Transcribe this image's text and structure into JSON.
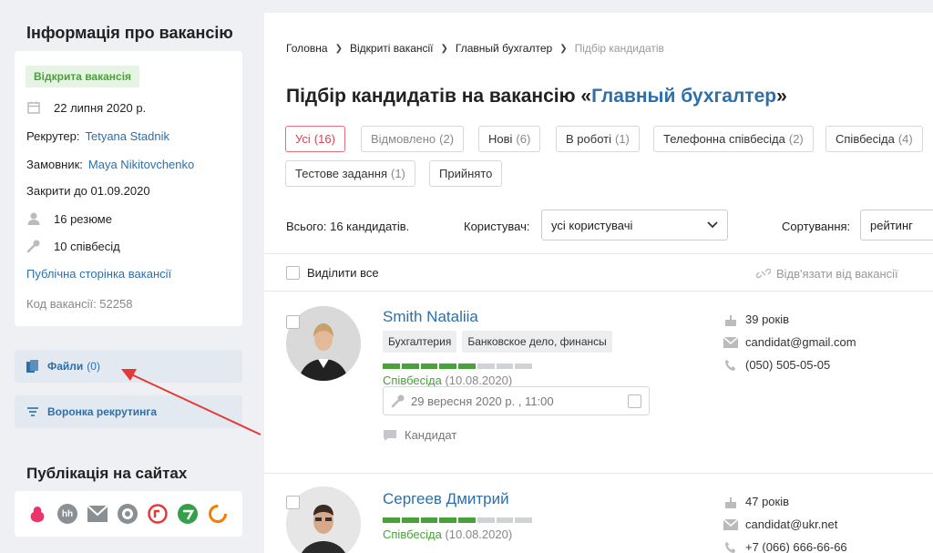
{
  "sidebar": {
    "title": "Інформація про вакансію",
    "status_badge": "Відкрита вакансія",
    "date": "22 липня 2020 р.",
    "recruiter_label": "Рекрутер:",
    "recruiter_name": "Tetyana Stadnik",
    "customer_label": "Замовник:",
    "customer_name": "Maya Nikitovchenko",
    "close_by": "Закрити до 01.09.2020",
    "resumes": "16 резюме",
    "interviews": "10 співбесід",
    "public_link": "Публічна сторінка вакансії",
    "vacancy_code": "Код вакансії: 52258",
    "files_label": "Файли",
    "files_count": "(0)",
    "funnel_label": "Воронка рекрутинга",
    "publication_title": "Публікація на сайтах"
  },
  "breadcrumb": {
    "home": "Головна",
    "open_vacancies": "Відкриті вакансії",
    "vacancy": "Главный бухгалтер",
    "current": "Підбір кандидатів"
  },
  "page": {
    "title_prefix": "Підбір кандидатів на вакансію «",
    "title_vacancy": "Главный бухгалтер",
    "title_suffix": "»"
  },
  "tabs": [
    {
      "label": "Усі",
      "count": "(16)"
    },
    {
      "label": "Відмовлено",
      "count": "(2)"
    },
    {
      "label": "Нові",
      "count": "(6)"
    },
    {
      "label": "В роботі",
      "count": "(1)"
    },
    {
      "label": "Телефонна співбесіда",
      "count": "(2)"
    },
    {
      "label": "Співбесіда",
      "count": "(4)"
    },
    {
      "label": "Тестове задання",
      "count": "(1)"
    },
    {
      "label": "Прийнято",
      "count": ""
    }
  ],
  "filters": {
    "total": "Всього: 16 кандидатів.",
    "user_label": "Користувач:",
    "user_value": "усі користувачі",
    "sort_label": "Сортування:",
    "sort_value": "рейтинг"
  },
  "list": {
    "select_all": "Виділити все",
    "unlink": "Відв'язати від вакансії"
  },
  "candidates": [
    {
      "name": "Smith Nataliia",
      "tags": [
        "Бухгалтерия",
        "Банковское дело, финансы"
      ],
      "progress_steps": 8,
      "progress_done": 5,
      "stage": "Співбесіда",
      "stage_date": "(10.08.2020)",
      "interview_date": "29 вересня 2020 р. , 11:00",
      "note": "Кандидат",
      "age": "39 років",
      "email": "candidat@gmail.com",
      "phone": "(050) 505-05-05"
    },
    {
      "name": "Сергеев Дмитрий",
      "tags": [],
      "progress_steps": 8,
      "progress_done": 5,
      "stage": "Співбесіда",
      "stage_date": "(10.08.2020)",
      "age": "47 років",
      "email": "candidat@ukr.net",
      "phone": "+7 (066) 666-66-66"
    }
  ],
  "colors": {
    "accent": "#2e6fa8",
    "success": "#4aa13b",
    "active_tab": "#d64555",
    "annotation_arrow": "#e53935"
  }
}
